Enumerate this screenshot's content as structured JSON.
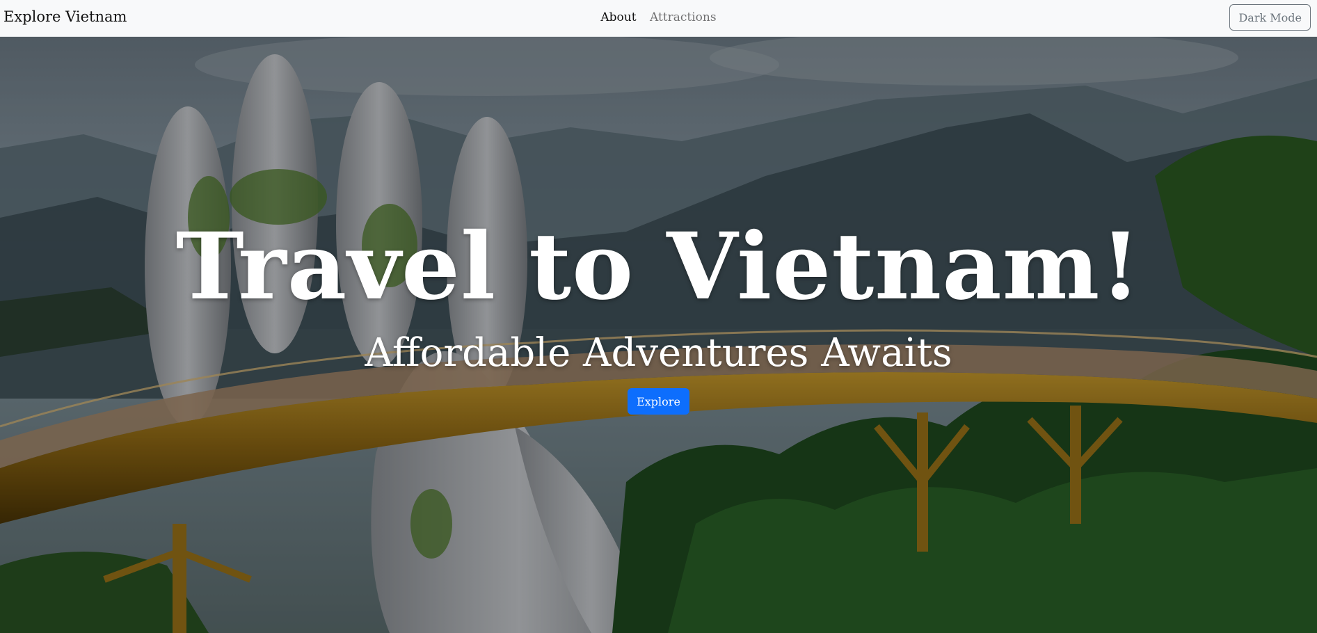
{
  "navbar": {
    "brand": "Explore Vietnam",
    "links": [
      {
        "label": "About",
        "active": true
      },
      {
        "label": "Attractions",
        "active": false
      }
    ],
    "mode_toggle_label": "Dark Mode"
  },
  "hero": {
    "title": "Travel to Vietnam!",
    "subtitle": "Affordable Adventures Awaits",
    "cta_label": "Explore",
    "background_image": "golden-bridge-hands-photo"
  },
  "colors": {
    "navbar_bg": "#f8f9fa",
    "primary": "#0d6efd",
    "secondary": "#6c757d",
    "hero_text": "#ffffff"
  }
}
